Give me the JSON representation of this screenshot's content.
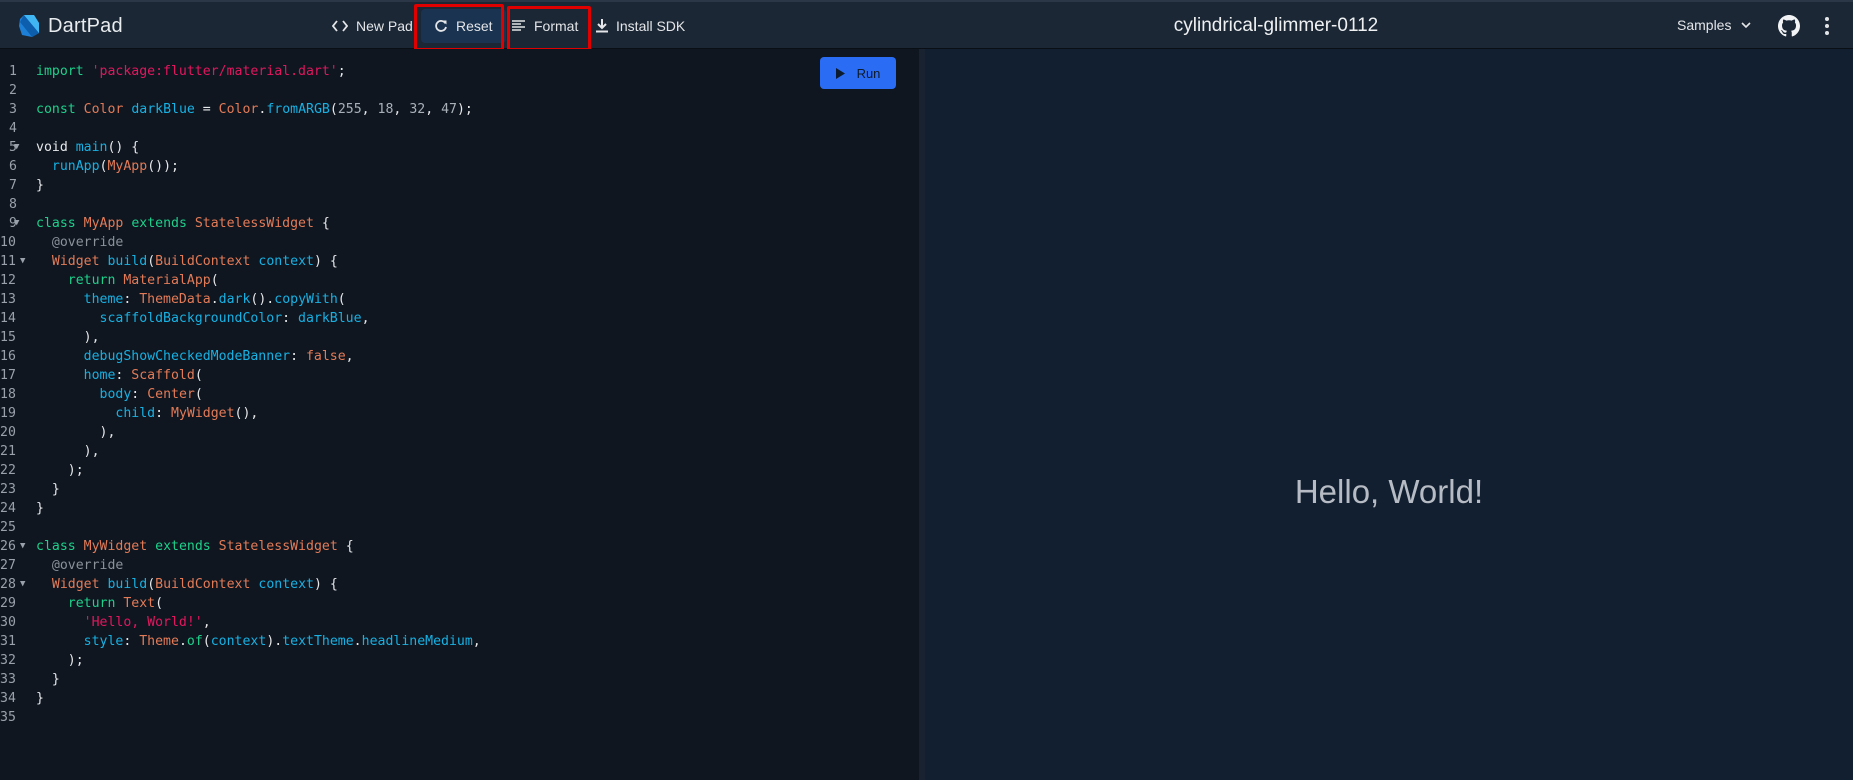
{
  "app": {
    "name": "DartPad",
    "pad_title": "cylindrical-glimmer-0112"
  },
  "toolbar": {
    "new_pad": {
      "label": "New Pad",
      "icon": "code-brackets-icon"
    },
    "reset": {
      "label": "Reset",
      "icon": "refresh-icon",
      "highlighted": true
    },
    "format": {
      "label": "Format",
      "icon": "format-align-icon",
      "highlighted": true
    },
    "install_sdk": {
      "label": "Install SDK",
      "icon": "download-icon"
    },
    "samples": {
      "label": "Samples",
      "icon": "chevron-down-icon"
    },
    "github": {
      "icon": "github-icon"
    },
    "more": {
      "icon": "more-vert-icon"
    }
  },
  "editor": {
    "run_label": "Run",
    "lines": [
      {
        "n": "1",
        "fold": false,
        "tokens": [
          [
            "k",
            "import"
          ],
          [
            "p",
            " "
          ],
          [
            "s",
            "'package:flutter/material.dart'"
          ],
          [
            "p",
            ";"
          ]
        ]
      },
      {
        "n": "2",
        "fold": false,
        "tokens": []
      },
      {
        "n": "3",
        "fold": false,
        "tokens": [
          [
            "k",
            "const"
          ],
          [
            "p",
            " "
          ],
          [
            "c",
            "Color"
          ],
          [
            "p",
            " "
          ],
          [
            "f",
            "darkBlue"
          ],
          [
            "p",
            " = "
          ],
          [
            "c",
            "Color"
          ],
          [
            "p",
            "."
          ],
          [
            "f",
            "fromARGB"
          ],
          [
            "p",
            "("
          ],
          [
            "n",
            "255"
          ],
          [
            "p",
            ", "
          ],
          [
            "n",
            "18"
          ],
          [
            "p",
            ", "
          ],
          [
            "n",
            "32"
          ],
          [
            "p",
            ", "
          ],
          [
            "n",
            "47"
          ],
          [
            "p",
            ");"
          ]
        ]
      },
      {
        "n": "4",
        "fold": false,
        "tokens": []
      },
      {
        "n": "5",
        "fold": true,
        "tokens": [
          [
            "p",
            "void "
          ],
          [
            "f",
            "main"
          ],
          [
            "p",
            "() {"
          ]
        ]
      },
      {
        "n": "6",
        "fold": false,
        "tokens": [
          [
            "p",
            "  "
          ],
          [
            "f",
            "runApp"
          ],
          [
            "p",
            "("
          ],
          [
            "c",
            "MyApp"
          ],
          [
            "p",
            "());"
          ]
        ]
      },
      {
        "n": "7",
        "fold": false,
        "tokens": [
          [
            "p",
            "}"
          ]
        ]
      },
      {
        "n": "8",
        "fold": false,
        "tokens": []
      },
      {
        "n": "9",
        "fold": true,
        "tokens": [
          [
            "k",
            "class"
          ],
          [
            "p",
            " "
          ],
          [
            "c",
            "MyApp"
          ],
          [
            "p",
            " "
          ],
          [
            "k",
            "extends"
          ],
          [
            "p",
            " "
          ],
          [
            "c",
            "StatelessWidget"
          ],
          [
            "p",
            " {"
          ]
        ]
      },
      {
        "n": "10",
        "fold": false,
        "tokens": [
          [
            "p",
            "  "
          ],
          [
            "a",
            "@override"
          ]
        ]
      },
      {
        "n": "11",
        "fold": true,
        "tokens": [
          [
            "p",
            "  "
          ],
          [
            "c",
            "Widget"
          ],
          [
            "p",
            " "
          ],
          [
            "f",
            "build"
          ],
          [
            "p",
            "("
          ],
          [
            "c",
            "BuildContext"
          ],
          [
            "p",
            " "
          ],
          [
            "f",
            "context"
          ],
          [
            "p",
            ") {"
          ]
        ]
      },
      {
        "n": "12",
        "fold": false,
        "tokens": [
          [
            "p",
            "    "
          ],
          [
            "k",
            "return"
          ],
          [
            "p",
            " "
          ],
          [
            "c",
            "MaterialApp"
          ],
          [
            "p",
            "("
          ]
        ]
      },
      {
        "n": "13",
        "fold": false,
        "tokens": [
          [
            "p",
            "      "
          ],
          [
            "f",
            "theme"
          ],
          [
            "p",
            ": "
          ],
          [
            "c",
            "ThemeData"
          ],
          [
            "p",
            "."
          ],
          [
            "f",
            "dark"
          ],
          [
            "p",
            "()."
          ],
          [
            "f",
            "copyWith"
          ],
          [
            "p",
            "("
          ]
        ]
      },
      {
        "n": "14",
        "fold": false,
        "tokens": [
          [
            "p",
            "        "
          ],
          [
            "f",
            "scaffoldBackgroundColor"
          ],
          [
            "p",
            ": "
          ],
          [
            "f",
            "darkBlue"
          ],
          [
            "p",
            ","
          ]
        ]
      },
      {
        "n": "15",
        "fold": false,
        "tokens": [
          [
            "p",
            "      ),"
          ]
        ]
      },
      {
        "n": "16",
        "fold": false,
        "tokens": [
          [
            "p",
            "      "
          ],
          [
            "f",
            "debugShowCheckedModeBanner"
          ],
          [
            "p",
            ": "
          ],
          [
            "c",
            "false"
          ],
          [
            "p",
            ","
          ]
        ]
      },
      {
        "n": "17",
        "fold": false,
        "tokens": [
          [
            "p",
            "      "
          ],
          [
            "f",
            "home"
          ],
          [
            "p",
            ": "
          ],
          [
            "c",
            "Scaffold"
          ],
          [
            "p",
            "("
          ]
        ]
      },
      {
        "n": "18",
        "fold": false,
        "tokens": [
          [
            "p",
            "        "
          ],
          [
            "f",
            "body"
          ],
          [
            "p",
            ": "
          ],
          [
            "c",
            "Center"
          ],
          [
            "p",
            "("
          ]
        ]
      },
      {
        "n": "19",
        "fold": false,
        "tokens": [
          [
            "p",
            "          "
          ],
          [
            "f",
            "child"
          ],
          [
            "p",
            ": "
          ],
          [
            "c",
            "MyWidget"
          ],
          [
            "p",
            "(),"
          ]
        ]
      },
      {
        "n": "20",
        "fold": false,
        "tokens": [
          [
            "p",
            "        ),"
          ]
        ]
      },
      {
        "n": "21",
        "fold": false,
        "tokens": [
          [
            "p",
            "      ),"
          ]
        ]
      },
      {
        "n": "22",
        "fold": false,
        "tokens": [
          [
            "p",
            "    );"
          ]
        ]
      },
      {
        "n": "23",
        "fold": false,
        "tokens": [
          [
            "p",
            "  }"
          ]
        ]
      },
      {
        "n": "24",
        "fold": false,
        "tokens": [
          [
            "p",
            "}"
          ]
        ]
      },
      {
        "n": "25",
        "fold": false,
        "tokens": []
      },
      {
        "n": "26",
        "fold": true,
        "tokens": [
          [
            "k",
            "class"
          ],
          [
            "p",
            " "
          ],
          [
            "c",
            "MyWidget"
          ],
          [
            "p",
            " "
          ],
          [
            "k",
            "extends"
          ],
          [
            "p",
            " "
          ],
          [
            "c",
            "StatelessWidget"
          ],
          [
            "p",
            " {"
          ]
        ]
      },
      {
        "n": "27",
        "fold": false,
        "tokens": [
          [
            "p",
            "  "
          ],
          [
            "a",
            "@override"
          ]
        ]
      },
      {
        "n": "28",
        "fold": true,
        "tokens": [
          [
            "p",
            "  "
          ],
          [
            "c",
            "Widget"
          ],
          [
            "p",
            " "
          ],
          [
            "f",
            "build"
          ],
          [
            "p",
            "("
          ],
          [
            "c",
            "BuildContext"
          ],
          [
            "p",
            " "
          ],
          [
            "f",
            "context"
          ],
          [
            "p",
            ") {"
          ]
        ]
      },
      {
        "n": "29",
        "fold": false,
        "tokens": [
          [
            "p",
            "    "
          ],
          [
            "k",
            "return"
          ],
          [
            "p",
            " "
          ],
          [
            "c",
            "Text"
          ],
          [
            "p",
            "("
          ]
        ]
      },
      {
        "n": "30",
        "fold": false,
        "tokens": [
          [
            "p",
            "      "
          ],
          [
            "s",
            "'Hello, World!'"
          ],
          [
            "p",
            ","
          ]
        ]
      },
      {
        "n": "31",
        "fold": false,
        "tokens": [
          [
            "p",
            "      "
          ],
          [
            "f",
            "style"
          ],
          [
            "p",
            ": "
          ],
          [
            "c",
            "Theme"
          ],
          [
            "p",
            "."
          ],
          [
            "k",
            "of"
          ],
          [
            "p",
            "("
          ],
          [
            "f",
            "context"
          ],
          [
            "p",
            ")."
          ],
          [
            "f",
            "textTheme"
          ],
          [
            "p",
            "."
          ],
          [
            "f",
            "headlineMedium"
          ],
          [
            "p",
            ","
          ]
        ]
      },
      {
        "n": "32",
        "fold": false,
        "tokens": [
          [
            "p",
            "    );"
          ]
        ]
      },
      {
        "n": "33",
        "fold": false,
        "tokens": [
          [
            "p",
            "  }"
          ]
        ]
      },
      {
        "n": "34",
        "fold": false,
        "tokens": [
          [
            "p",
            "}"
          ]
        ]
      },
      {
        "n": "35",
        "fold": false,
        "tokens": []
      }
    ]
  },
  "preview": {
    "output_text": "Hello, World!"
  },
  "colors": {
    "accent": "#2a6df4",
    "highlight": "#e00000",
    "topbar": "#1b2735",
    "editor_bg": "#0f1620",
    "preview_bg": "#121f31"
  }
}
